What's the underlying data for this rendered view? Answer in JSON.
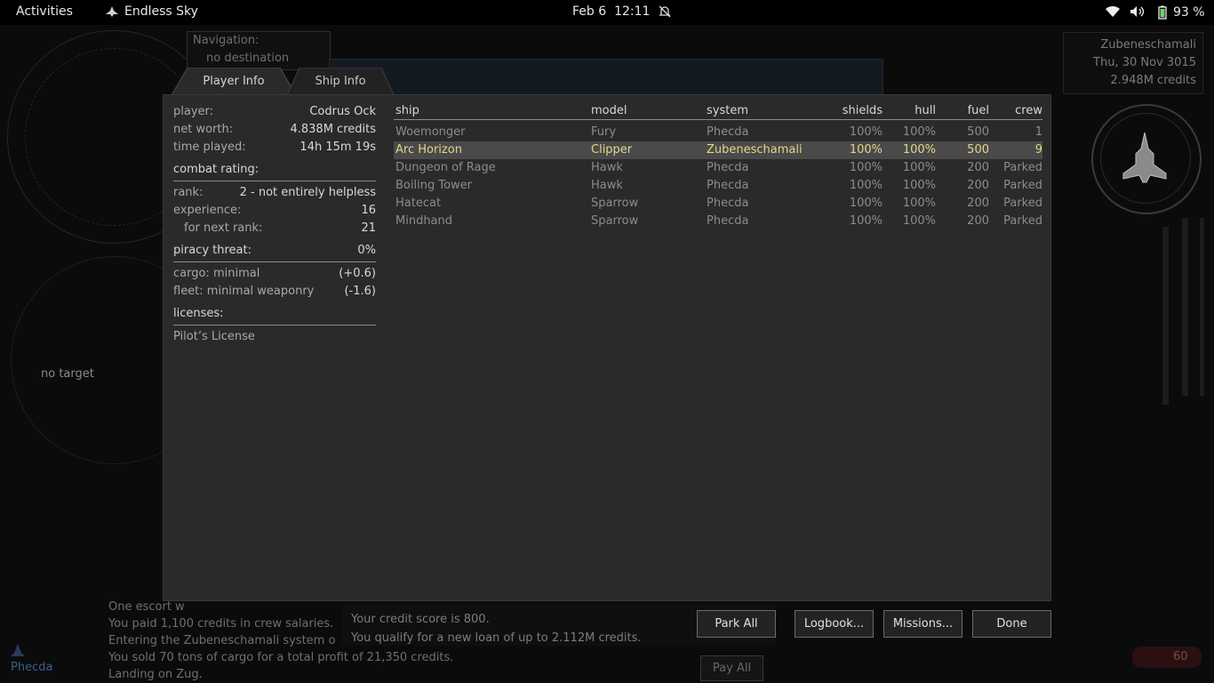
{
  "topbar": {
    "activities": "Activities",
    "app_name": "Endless Sky",
    "date": "Feb 6",
    "time": "12:11",
    "battery": "93 %"
  },
  "hud": {
    "navigation_label": "Navigation:",
    "navigation_value": "no destination",
    "target": "no target",
    "system_name": "Zubeneschamali",
    "date": "Thu, 30 Nov 3015",
    "credits": "2.948M credits",
    "planet_label": "Phecda",
    "speed": "60"
  },
  "tabs": [
    {
      "label": "Player Info",
      "active": true
    },
    {
      "label": "Ship Info",
      "active": false
    }
  ],
  "player": {
    "rows": [
      {
        "label": "player:",
        "value": "Codrus Ock"
      },
      {
        "label": "net worth:",
        "value": "4.838M credits"
      },
      {
        "label": "time played:",
        "value": "14h 15m 19s"
      }
    ],
    "combat_header": "combat rating:",
    "combat_rows": [
      {
        "label": "rank:",
        "value": "2 - not entirely helpless"
      },
      {
        "label": "experience:",
        "value": "16"
      },
      {
        "label": "for next rank:",
        "value": "21"
      }
    ],
    "piracy_header": "piracy threat:",
    "piracy_value": "0%",
    "piracy_rows": [
      {
        "label": "cargo: minimal",
        "value": "(+0.6)"
      },
      {
        "label": "fleet: minimal weaponry",
        "value": "(-1.6)"
      }
    ],
    "licenses_header": "licenses:",
    "licenses": [
      "Pilot’s License"
    ]
  },
  "fleet": {
    "columns": [
      "ship",
      "model",
      "system",
      "shields",
      "hull",
      "fuel",
      "crew"
    ],
    "rows": [
      {
        "ship": "Woemonger",
        "model": "Fury",
        "system": "Phecda",
        "shields": "100%",
        "hull": "100%",
        "fuel": "500",
        "crew": "1",
        "selected": false
      },
      {
        "ship": "Arc Horizon",
        "model": "Clipper",
        "system": "Zubeneschamali",
        "shields": "100%",
        "hull": "100%",
        "fuel": "500",
        "crew": "9",
        "selected": true
      },
      {
        "ship": "Dungeon of Rage",
        "model": "Hawk",
        "system": "Phecda",
        "shields": "100%",
        "hull": "100%",
        "fuel": "200",
        "crew": "Parked",
        "selected": false
      },
      {
        "ship": "Boiling Tower",
        "model": "Hawk",
        "system": "Phecda",
        "shields": "100%",
        "hull": "100%",
        "fuel": "200",
        "crew": "Parked",
        "selected": false
      },
      {
        "ship": "Hatecat",
        "model": "Sparrow",
        "system": "Phecda",
        "shields": "100%",
        "hull": "100%",
        "fuel": "200",
        "crew": "Parked",
        "selected": false
      },
      {
        "ship": "Mindhand",
        "model": "Sparrow",
        "system": "Phecda",
        "shields": "100%",
        "hull": "100%",
        "fuel": "200",
        "crew": "Parked",
        "selected": false
      }
    ]
  },
  "buttons": {
    "park_all": "Park All",
    "logbook": "Logbook...",
    "missions": "Missions...",
    "done": "Done",
    "pay_all": "Pay All"
  },
  "messages": {
    "credit_score": "Your credit score is 800.",
    "loan": "You qualify for a new loan of up to 2.112M credits.",
    "log": [
      "One escort w",
      "You paid 1,100 credits in crew salaries.",
      "Entering the Zubeneschamali system o",
      "You sold 70 tons of cargo for a total profit of 21,350 credits.",
      "Landing on Zug."
    ]
  },
  "colors": {
    "panel": "#2a2a2a",
    "selected_row": "#4a4a4a",
    "selected_text": "#e3d68a"
  }
}
